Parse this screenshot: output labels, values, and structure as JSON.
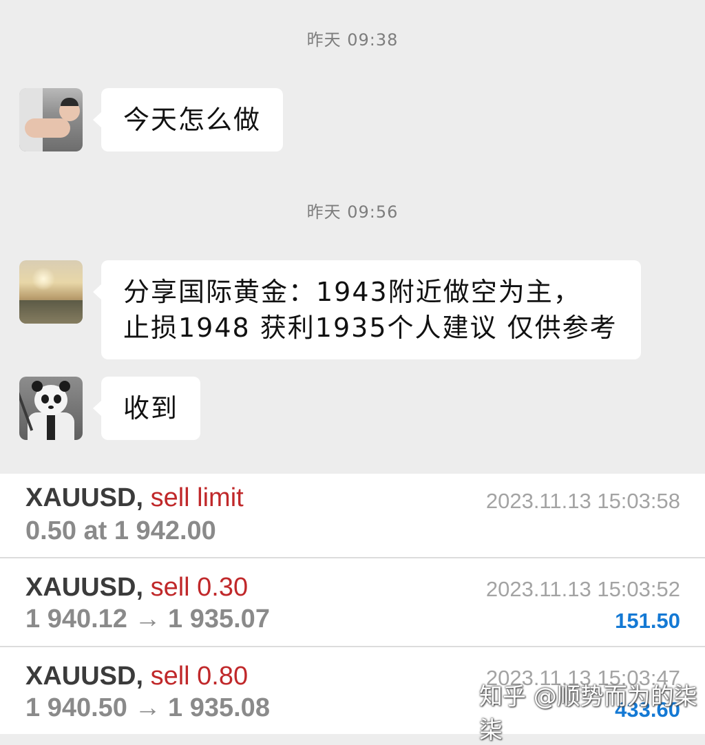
{
  "chat": {
    "messages": [
      {
        "timestamp": "昨天 09:38",
        "text_lines": [
          "今天怎么做"
        ],
        "avatar": "baby-photo-avatar"
      },
      {
        "timestamp": "昨天 09:56",
        "text_lines": [
          "分享国际黄金：1943附近做空为主，",
          "止损1948 获利1935个人建议 仅供参考"
        ],
        "avatar": "sunset-landscape-avatar"
      },
      {
        "text_lines": [
          "收到"
        ],
        "avatar": "panda-avatar"
      }
    ]
  },
  "trades": [
    {
      "symbol": "XAUUSD,",
      "type": "sell limit",
      "detail": "0.50 at 1 942.00",
      "time": "2023.11.13 15:03:58",
      "profit": ""
    },
    {
      "symbol": "XAUUSD,",
      "type": "sell 0.30",
      "detail": "1 940.12 → 1 935.07",
      "time": "2023.11.13 15:03:52",
      "profit": "151.50"
    },
    {
      "symbol": "XAUUSD,",
      "type": "sell 0.80",
      "detail": "1 940.50 → 1 935.08",
      "time": "2023.11.13 15:03:47",
      "profit": "433.60"
    }
  ],
  "colors": {
    "sell": "#c0282a",
    "profit": "#1479d4",
    "chat_bg": "#ededed"
  },
  "watermark": "知乎 @顺势而为的柒柒"
}
